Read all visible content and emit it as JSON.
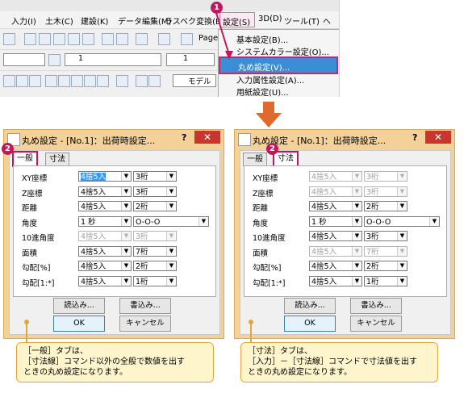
{
  "app": {
    "menu": [
      "入力(I)",
      "土木(C)",
      "建設(K)",
      "データ編集(M)",
      "ラスベク変換(B)",
      "設定(S)",
      "3D(D)",
      "ツール(T)",
      "ヘ"
    ],
    "toolbar_page_label": "Page",
    "combo1_value": "1",
    "combo2_value": "1",
    "combo3_value": "モデル"
  },
  "dropdown": {
    "items": [
      "基本設定(B)...",
      "システムカラー設定(O)...",
      "丸め設定(V)...",
      "入力属性設定(A)...",
      "用紙設定(U)..."
    ]
  },
  "badges": {
    "one": "1",
    "two": "2"
  },
  "dialog_left": {
    "title": "丸め設定 - [No.1]：出荷時設定...",
    "help": "?",
    "close": "✕",
    "tabs": [
      "一般",
      "寸法"
    ],
    "active_tab": "一般",
    "rows": [
      {
        "label": "XY座標",
        "a": "4捨5入",
        "b": "3桁",
        "a_disabled": false,
        "b_disabled": false,
        "a_highlight": true
      },
      {
        "label": "Z座標",
        "a": "4捨5入",
        "b": "3桁",
        "a_disabled": false,
        "b_disabled": false
      },
      {
        "label": "距離",
        "a": "4捨5入",
        "b": "2桁",
        "a_disabled": false,
        "b_disabled": false
      },
      {
        "label": "角度",
        "a": "1 秒",
        "b": "O-O-O",
        "a_disabled": false,
        "b_disabled": false,
        "wide": true
      },
      {
        "label": "10進角度",
        "a": "4捨5入",
        "b": "3桁",
        "a_disabled": true,
        "b_disabled": true
      },
      {
        "label": "面積",
        "a": "4捨5入",
        "b": "7桁",
        "a_disabled": false,
        "b_disabled": false
      },
      {
        "label": "勾配[%]",
        "a": "4捨5入",
        "b": "2桁",
        "a_disabled": false,
        "b_disabled": false
      },
      {
        "label": "勾配[1:*]",
        "a": "4捨5入",
        "b": "1桁",
        "a_disabled": false,
        "b_disabled": false
      }
    ],
    "read_button": "読込み...",
    "write_button": "書込み...",
    "ok_button": "OK",
    "cancel_button": "キャンセル"
  },
  "dialog_right": {
    "title": "丸め設定 - [No.1]：出荷時設定...",
    "help": "?",
    "close": "✕",
    "tabs": [
      "一般",
      "寸法"
    ],
    "active_tab": "寸法",
    "rows": [
      {
        "label": "XY座標",
        "a": "4捨5入",
        "b": "3桁",
        "a_disabled": true,
        "b_disabled": true
      },
      {
        "label": "Z座標",
        "a": "4捨5入",
        "b": "3桁",
        "a_disabled": true,
        "b_disabled": true
      },
      {
        "label": "距離",
        "a": "4捨5入",
        "b": "2桁",
        "a_disabled": false,
        "b_disabled": false
      },
      {
        "label": "角度",
        "a": "1 秒",
        "b": "O-O-O",
        "a_disabled": false,
        "b_disabled": false,
        "wide": true
      },
      {
        "label": "10進角度",
        "a": "4捨5入",
        "b": "3桁",
        "a_disabled": false,
        "b_disabled": false
      },
      {
        "label": "面積",
        "a": "4捨5入",
        "b": "7桁",
        "a_disabled": true,
        "b_disabled": true
      },
      {
        "label": "勾配[%]",
        "a": "4捨5入",
        "b": "2桁",
        "a_disabled": false,
        "b_disabled": false
      },
      {
        "label": "勾配[1:*]",
        "a": "4捨5入",
        "b": "1桁",
        "a_disabled": false,
        "b_disabled": false
      }
    ],
    "read_button": "読込み...",
    "write_button": "書込み...",
    "ok_button": "OK",
    "cancel_button": "キャンセル"
  },
  "callout_left": [
    "［一般］タブは、",
    "［寸法線］コマンド以外の全般で数値を出す",
    "ときの丸め設定になります。"
  ],
  "callout_right": [
    "［寸法］タブは、",
    "［入力］－［寸法線］コマンドで寸法値を出す",
    "ときの丸め設定になります。"
  ],
  "colors": {
    "accent": "#c2185b",
    "arrow": "#e06a2c",
    "dialog_frame": "#f3d199",
    "callout_bg": "#fff5cc",
    "callout_border": "#e0a83c",
    "menu_highlight": "#3b8ed6"
  }
}
